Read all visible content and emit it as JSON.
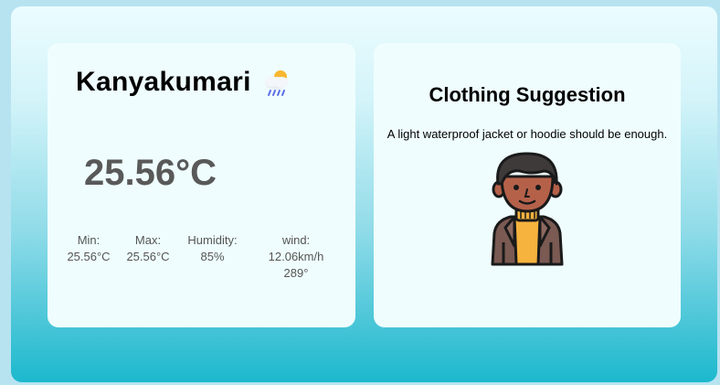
{
  "weather": {
    "city": "Kanyakumari",
    "icon": "rain-cloud-sun-icon",
    "temperature": "25.56°C",
    "min": {
      "label": "Min:",
      "value": "25.56°C"
    },
    "max": {
      "label": "Max:",
      "value": "25.56°C"
    },
    "humidity": {
      "label": "Humidity:",
      "value": "85%"
    },
    "wind": {
      "label": "wind:",
      "speed": "12.06km/h",
      "direction": "289°"
    }
  },
  "clothing": {
    "title": "Clothing Suggestion",
    "suggestion": "A light waterproof jacket or hoodie should be enough.",
    "image": "person-in-jacket-icon"
  },
  "colors": {
    "gradient_top": "#ecfcff",
    "gradient_bottom": "#1cb8cd",
    "card_bg": "#effdfe"
  }
}
